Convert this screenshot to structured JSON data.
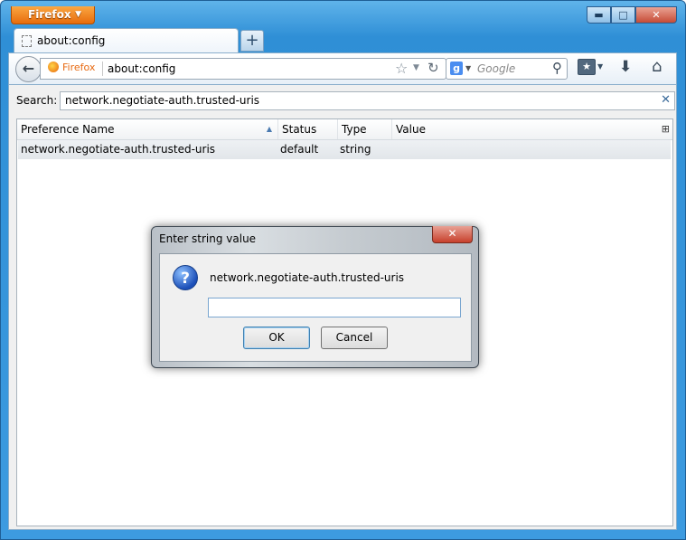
{
  "app": {
    "menu_button": "Firefox",
    "window_controls": {
      "minimize": "▬",
      "maximize": "□",
      "close": "✕"
    }
  },
  "tab": {
    "title": "about:config",
    "new_tab": "+"
  },
  "navbar": {
    "identity_label": "Firefox",
    "url": "about:config",
    "search_placeholder": "Google",
    "search_engine_letter": "g"
  },
  "config": {
    "search_label": "Search:",
    "search_value": "network.negotiate-auth.trusted-uris",
    "columns": [
      "Preference Name",
      "Status",
      "Type",
      "Value"
    ],
    "rows": [
      {
        "name": "network.negotiate-auth.trusted-uris",
        "status": "default",
        "type": "string",
        "value": ""
      }
    ]
  },
  "dialog": {
    "title": "Enter string value",
    "message": "network.negotiate-auth.trusted-uris",
    "input_value": "",
    "ok_label": "OK",
    "cancel_label": "Cancel",
    "close_label": "✕"
  },
  "icons": [
    "back-arrow-icon",
    "star-icon",
    "reload-icon",
    "search-icon",
    "bookmarks-icon",
    "download-icon",
    "home-icon",
    "question-icon",
    "clear-icon",
    "sort-ascending-icon",
    "column-picker-icon"
  ]
}
